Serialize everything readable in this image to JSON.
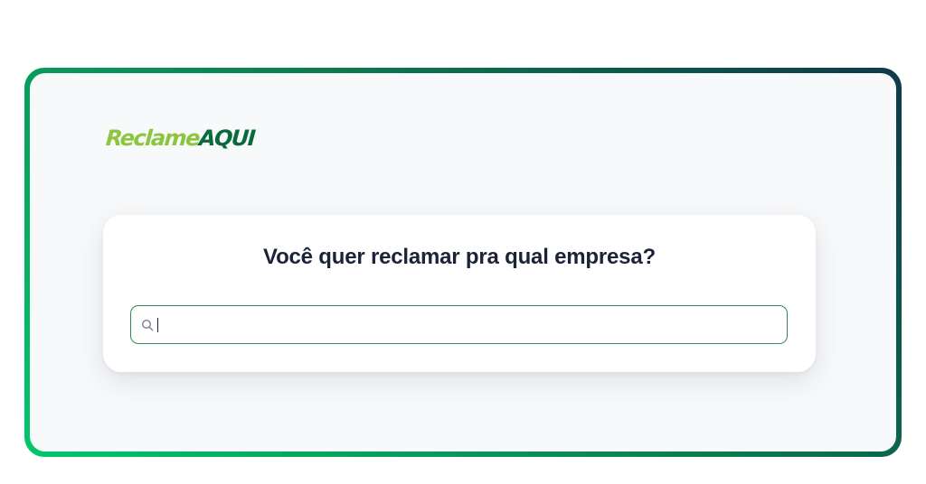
{
  "logo": {
    "part1": "Reclame",
    "part2": "AQUI",
    "colors": {
      "part1": "#8cc63f",
      "part2": "#0a6b3a"
    }
  },
  "search_card": {
    "title": "Você quer reclamar pra qual empresa?",
    "input": {
      "value": "",
      "icon": "search-icon"
    }
  },
  "colors": {
    "frame_gradient": [
      "#00c86b",
      "#0c7a4e",
      "#0d3a4a"
    ],
    "input_border": "#2f8a57",
    "title_text": "#1c2237",
    "panel_background": "#f8f9fa"
  }
}
